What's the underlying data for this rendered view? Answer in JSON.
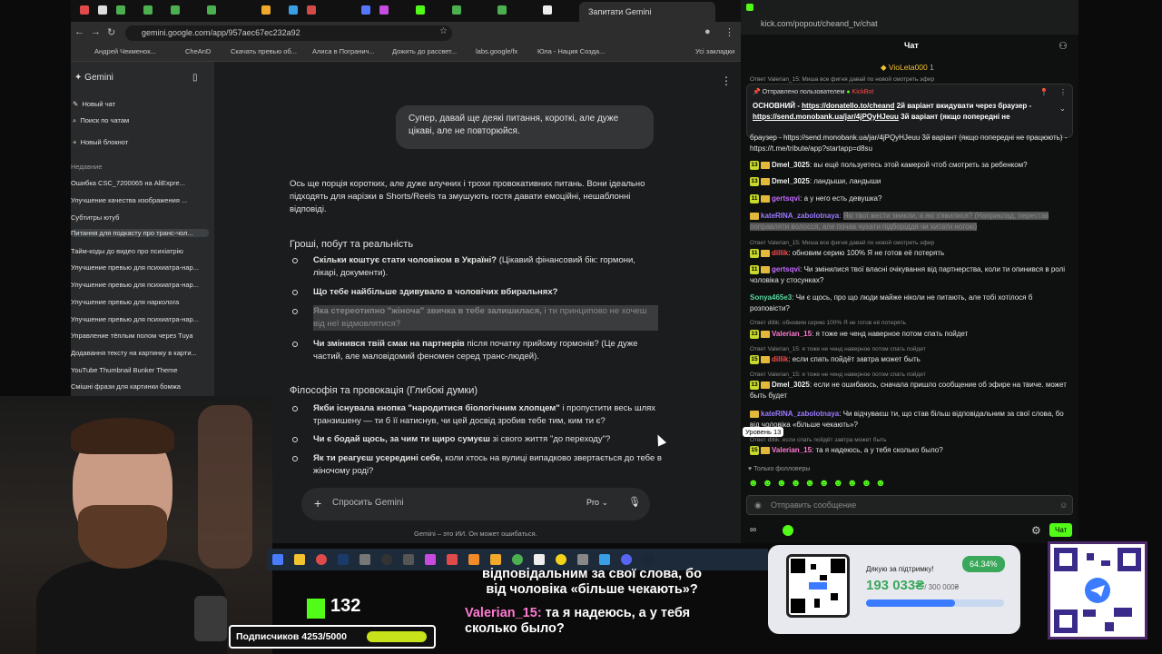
{
  "browser": {
    "tab_title": "Запитати Gemini",
    "url": "gemini.google.com/app/957aec67ec232a92",
    "bookmarks": [
      "Андрей Чекменок...",
      "CheAnD",
      "Скачать превью об...",
      "Алиса в Погранич...",
      "Дожить до рассвет...",
      "labs.google/fx",
      "Юла - Нация Созда...",
      "Усі закладки"
    ]
  },
  "gemini": {
    "brand": "Gemini",
    "new_chat": "Новый чат",
    "search_chats": "Поиск по чатам",
    "new_block": "Новый блокнот",
    "recent_label": "Недавние",
    "recent_items": [
      "Ошибка CSC_7200065 на AliExpre...",
      "Улучшение качества изображения ...",
      "Субтитры ютуб",
      "Питання для подкасту про транс-чол...",
      "Тайм-коды до видео про психіатрію",
      "Улучшение превью для психиатра-нар...",
      "Улучшение превью для психиатра-нар...",
      "Улучшение превью для нарколога",
      "Улучшение превью для психиатра-нар...",
      "Управление тёплым полом через Tuya",
      "Додавання тексту на картинку в карти...",
      "YouTube Thumbnail Bunker Theme",
      "Смішні фрази для картинки бомжа"
    ],
    "user_message": "Супер, давай ще деякі питання, короткі, але дуже цікаві, але не повторюйся.",
    "intro": "Ось ще порція коротких, але дуже влучних і трохи провокативних питань. Вони ідеально підходять для нарізки в Shorts/Reels та змушують гостя давати емоційні, нешаблонні відповіді.",
    "section1": "Гроші, побут та реальність",
    "s1_bullets": [
      {
        "bold": "Скільки коштує стати чоловіком в Україні?",
        "rest": " (Цікавий фінансовий бік: гормони, лікарі, документи)."
      },
      {
        "bold": "Що тебе найбільше здивувало в чоловічих вбиральнях?",
        "rest": ""
      },
      {
        "bold": "Яка стереотипно \"жіноча\" звичка в тебе залишилася,",
        "rest": " і ти принципово не хочеш від неї відмовлятися?"
      },
      {
        "bold": "Чи змінився твій смак на партнерів",
        "rest": " після початку прийому гормонів? (Це дуже частий, але маловідомий феномен серед транс-людей)."
      }
    ],
    "section2": "Філософія та провокація (Глибокі думки)",
    "s2_bullets": [
      {
        "bold": "Якби існувала кнопка \"народитися біологічним хлопцем\"",
        "rest": " і пропустити весь шлях транзишену — ти б її натиснув, чи цей досвід зробив тебе тим, ким ти є?"
      },
      {
        "bold": "Чи є бодай щось, за чим ти щиро сумуєш",
        "rest": " зі свого життя \"до переходу\"?"
      },
      {
        "bold": "Як ти реагуєш усередині себе,",
        "rest": " коли хтось на вулиці випадково звертається до тебе в жіночому роді?"
      }
    ],
    "prompt_placeholder": "Спросить Gemini",
    "mode": "Pro",
    "disclaimer": "Gemini – это ИИ. Он может ошибаться."
  },
  "kick": {
    "url": "kick.com/popout/cheand_tv/chat",
    "header": "Чат",
    "top_user": "VioLeta000",
    "top_user_count": "1",
    "pinned_by": "Отправлено пользователем",
    "pinned_user": "KickBot",
    "pinned_text_1": "ОСНОВНИЙ - ",
    "pinned_link_1": "https://donatello.to/cheand",
    "pinned_text_2": " 2й варіант вкидувати через браузер - ",
    "pinned_link_2": "https://send.monobank.ua/jar/4jPQyHJeuu",
    "pinned_text_3": " 3й варіант (якщо попередні не",
    "msg_cont": "браузер - https://send.monobank.ua/jar/4jPQyHJeuu 3й варіант (якщо попередні не працюють) - https://t.me/tribute/app?startapp=d8su",
    "messages": [
      {
        "lvl": "13",
        "user": "Dmel_3025",
        "color": "#f2f2f2",
        "text": "вы ещё пользуетесь этой камерой чтоб смотреть за ребенком?"
      },
      {
        "lvl": "13",
        "user": "Dmel_3025",
        "color": "#f2f2f2",
        "text": "ландыши, ландыши"
      },
      {
        "lvl": "11",
        "user": "gertsqvi",
        "color": "#c46cff",
        "text": "а у него есть девушка?"
      },
      {
        "lvl": "",
        "user": "kateRINA_zabolotnaya",
        "color": "#9c7bff",
        "text": "Які твої жести зникли, а які з'явилися? (Наприклад, перестав поправляти волосся, але почав чухати підборіддя чи хитати ногою)"
      },
      {
        "lvl": "11",
        "user": "dillik",
        "color": "#ff4d4d",
        "text": "обновим серию 100% Я не готов её потерять"
      },
      {
        "lvl": "11",
        "user": "gertsqvi",
        "color": "#c46cff",
        "text": "Чи змінилися твої власні очікування від партнерства, коли ти опинився в ролі чоловіка у стосунках?"
      },
      {
        "lvl": "",
        "user": "Sonya465e3",
        "color": "#5ad6a0",
        "text": "Чи є щось, про що люди майже ніколи не питають, але тобі хотілося б розповісти?"
      },
      {
        "lvl": "13",
        "user": "Valerian_15",
        "color": "#ff7ad1",
        "text": "я тоже не ченд наверное потом спать пойдет"
      },
      {
        "lvl": "15",
        "user": "dillik",
        "color": "#ff4d4d",
        "text": "если спать пойдёт завтра может быть"
      },
      {
        "lvl": "13",
        "user": "Dmel_3025",
        "color": "#f2f2f2",
        "text": "если не ошибаюсь, сначала пришло сообщение об эфире на твиче. может быть будет"
      },
      {
        "lvl": "",
        "user": "kateRINA_zabolotnaya",
        "color": "#9c7bff",
        "text": "Чи відчуваєш ти, що став більш відповідальним за свої слова, бо від чоловіка «більше чекають»?"
      },
      {
        "lvl": "15",
        "user": "Valerian_15",
        "color": "#ff7ad1",
        "text": "та я надеюсь, а у тебя сколько было?"
      }
    ],
    "replies": [
      "Ответ Valerian_15: Миша все фигня давай по новой смотреть эфир",
      "Ответ dillik: обновим серию 100% Я не готов её потерять",
      "Ответ Valerian_15: я тоже не ченд наверное потом спать пойдет",
      "Ответ Valerian_15: я тоже не ченд наверное потом спать пойдет",
      "Ответ dillik: если спать пойдёт завтра может быть"
    ],
    "level_tooltip": "Уровень 13",
    "followers_only": "Только фолловеры",
    "send_placeholder": "Отправить сообщение",
    "chat_button": "Чат"
  },
  "overlay": {
    "kick_count": "132",
    "subs_label": "Подписчиков 4253/5000",
    "subs_progress": 0.85,
    "donation_title": "Дякую за підтримку!",
    "donation_percent": "64.34%",
    "donation_amount": "193 033₴",
    "donation_goal": "/ 300 000₴",
    "donation_progress": 0.6434,
    "chat_line1": "відповідальним за свої слова, бо",
    "chat_line2": "від чоловіка «більше чекають»?",
    "chat_user": "Valerian_15:",
    "chat_text": " та я надеюсь, а у тебя сколько было?"
  },
  "colors": {
    "kick_green": "#53fc18",
    "gemini_bg": "#1b1c1d",
    "donation_green": "#3aa85a"
  }
}
